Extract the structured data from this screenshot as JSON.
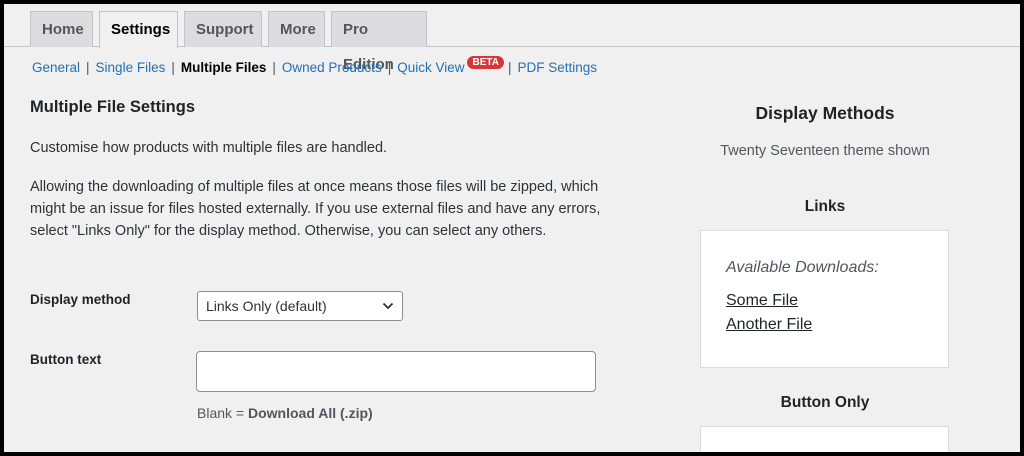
{
  "tabs": [
    "Home",
    "Settings",
    "Support",
    "More",
    "Pro Edition"
  ],
  "subnav": {
    "items": [
      "General",
      "Single Files",
      "Multiple Files",
      "Owned Products",
      "Quick View",
      "PDF Settings"
    ],
    "current": "Multiple Files",
    "badge": "BETA",
    "separator": "|"
  },
  "main": {
    "heading": "Multiple File Settings",
    "intro": "Customise how products with multiple files are handled.",
    "description": "Allowing the downloading of multiple files at once means those files will be zipped, which might be an issue for files hosted externally. If you use external files and have any errors, select \"Links Only\" for the display method. Otherwise, you can select any others.",
    "display_method": {
      "label": "Display method",
      "value": "Links Only (default)"
    },
    "button_text": {
      "label": "Button text",
      "value": "",
      "hint_prefix": "Blank = ",
      "hint_strong": "Download All (.zip)"
    }
  },
  "side": {
    "title": "Display Methods",
    "subtitle": "Twenty Seventeen theme shown",
    "links_title": "Links",
    "links_caption": "Available Downloads:",
    "links": [
      "Some File",
      "Another File"
    ],
    "button_only_title": "Button Only"
  },
  "colors": {
    "link": "#2271b1",
    "badge": "#d63638",
    "background": "#f0f0f1"
  }
}
